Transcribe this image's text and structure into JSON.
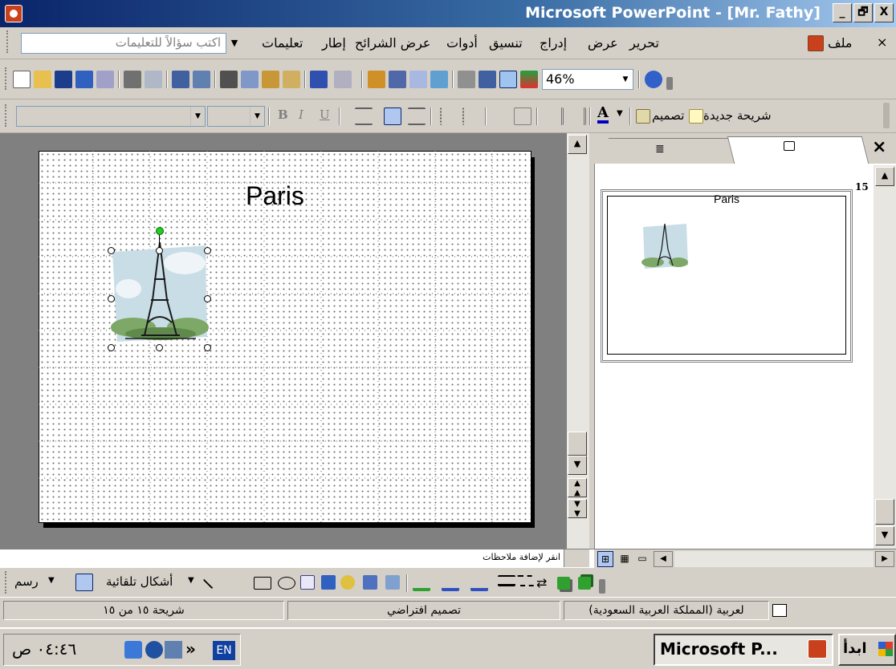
{
  "window": {
    "title": "Microsoft PowerPoint - [Mr. Fathy]",
    "buttons": [
      "_",
      "🗗",
      "X"
    ]
  },
  "menubar": {
    "close_doc": "×",
    "items": [
      "ملف",
      "تحرير",
      "عرض",
      "إدراج",
      "تنسيق",
      "أدوات",
      "عرض الشرائح",
      "إطار",
      "تعليمات"
    ],
    "help_placeholder": "اكتب سؤالاً للتعليمات"
  },
  "standard": {
    "zoom": "46%"
  },
  "formatting": {
    "new_slide": "شريحة جديدة",
    "design": "تصميم",
    "bold": "B",
    "italic": "I",
    "underline": "U",
    "font_color_letter": "A"
  },
  "slide": {
    "title": "Paris"
  },
  "pane": {
    "slide_number": "15",
    "thumb_title": "Paris"
  },
  "notes": {
    "placeholder": "انقر لإضافة ملاحظات"
  },
  "drawing": {
    "draw_menu": "رسم",
    "autoshapes": "أشكال تلقائية"
  },
  "status": {
    "slide_of": "شريحة ١٥ من ١٥",
    "design_name": "تصميم افتراضي",
    "language": "لعربية (المملكة العربية السعودية)"
  },
  "taskbar": {
    "start": "ابدأ",
    "task": "Microsoft P...",
    "lang": "EN",
    "time": "٠٤:٤٦ ص",
    "chevron": "»"
  },
  "colors": {
    "title_gradient_start": "#0a246a",
    "title_gradient_end": "#a6caf0",
    "face": "#d4d0c8",
    "workspace": "#808080"
  }
}
